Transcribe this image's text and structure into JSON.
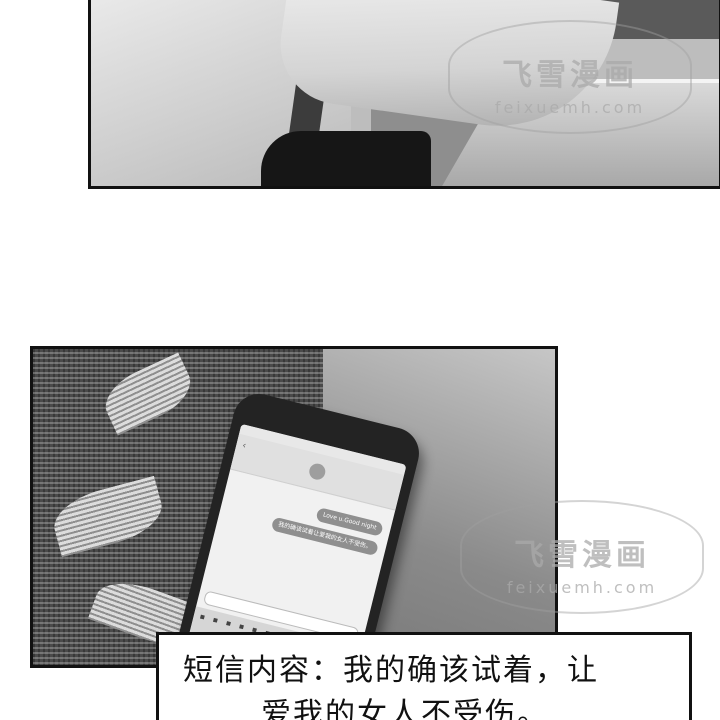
{
  "watermark": {
    "brand": "飞雪漫画",
    "url": "feixuemh.com"
  },
  "phone": {
    "bubble_1": "Love u.Good night",
    "bubble_2": "我的确该试着让爱我的女人不受伤。"
  },
  "caption": {
    "line_1": "短信内容：我的确该试着，让",
    "line_2": "爱我的女人不受伤。"
  }
}
